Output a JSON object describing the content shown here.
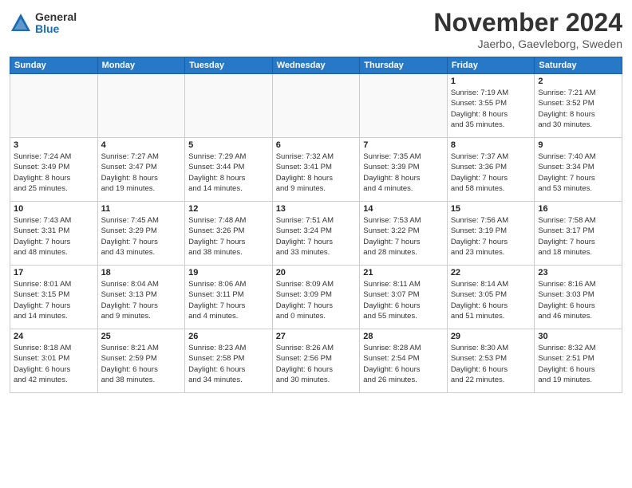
{
  "header": {
    "logo_general": "General",
    "logo_blue": "Blue",
    "month_title": "November 2024",
    "location": "Jaerbo, Gaevleborg, Sweden"
  },
  "weekdays": [
    "Sunday",
    "Monday",
    "Tuesday",
    "Wednesday",
    "Thursday",
    "Friday",
    "Saturday"
  ],
  "weeks": [
    [
      {
        "day": "",
        "info": ""
      },
      {
        "day": "",
        "info": ""
      },
      {
        "day": "",
        "info": ""
      },
      {
        "day": "",
        "info": ""
      },
      {
        "day": "",
        "info": ""
      },
      {
        "day": "1",
        "info": "Sunrise: 7:19 AM\nSunset: 3:55 PM\nDaylight: 8 hours\nand 35 minutes."
      },
      {
        "day": "2",
        "info": "Sunrise: 7:21 AM\nSunset: 3:52 PM\nDaylight: 8 hours\nand 30 minutes."
      }
    ],
    [
      {
        "day": "3",
        "info": "Sunrise: 7:24 AM\nSunset: 3:49 PM\nDaylight: 8 hours\nand 25 minutes."
      },
      {
        "day": "4",
        "info": "Sunrise: 7:27 AM\nSunset: 3:47 PM\nDaylight: 8 hours\nand 19 minutes."
      },
      {
        "day": "5",
        "info": "Sunrise: 7:29 AM\nSunset: 3:44 PM\nDaylight: 8 hours\nand 14 minutes."
      },
      {
        "day": "6",
        "info": "Sunrise: 7:32 AM\nSunset: 3:41 PM\nDaylight: 8 hours\nand 9 minutes."
      },
      {
        "day": "7",
        "info": "Sunrise: 7:35 AM\nSunset: 3:39 PM\nDaylight: 8 hours\nand 4 minutes."
      },
      {
        "day": "8",
        "info": "Sunrise: 7:37 AM\nSunset: 3:36 PM\nDaylight: 7 hours\nand 58 minutes."
      },
      {
        "day": "9",
        "info": "Sunrise: 7:40 AM\nSunset: 3:34 PM\nDaylight: 7 hours\nand 53 minutes."
      }
    ],
    [
      {
        "day": "10",
        "info": "Sunrise: 7:43 AM\nSunset: 3:31 PM\nDaylight: 7 hours\nand 48 minutes."
      },
      {
        "day": "11",
        "info": "Sunrise: 7:45 AM\nSunset: 3:29 PM\nDaylight: 7 hours\nand 43 minutes."
      },
      {
        "day": "12",
        "info": "Sunrise: 7:48 AM\nSunset: 3:26 PM\nDaylight: 7 hours\nand 38 minutes."
      },
      {
        "day": "13",
        "info": "Sunrise: 7:51 AM\nSunset: 3:24 PM\nDaylight: 7 hours\nand 33 minutes."
      },
      {
        "day": "14",
        "info": "Sunrise: 7:53 AM\nSunset: 3:22 PM\nDaylight: 7 hours\nand 28 minutes."
      },
      {
        "day": "15",
        "info": "Sunrise: 7:56 AM\nSunset: 3:19 PM\nDaylight: 7 hours\nand 23 minutes."
      },
      {
        "day": "16",
        "info": "Sunrise: 7:58 AM\nSunset: 3:17 PM\nDaylight: 7 hours\nand 18 minutes."
      }
    ],
    [
      {
        "day": "17",
        "info": "Sunrise: 8:01 AM\nSunset: 3:15 PM\nDaylight: 7 hours\nand 14 minutes."
      },
      {
        "day": "18",
        "info": "Sunrise: 8:04 AM\nSunset: 3:13 PM\nDaylight: 7 hours\nand 9 minutes."
      },
      {
        "day": "19",
        "info": "Sunrise: 8:06 AM\nSunset: 3:11 PM\nDaylight: 7 hours\nand 4 minutes."
      },
      {
        "day": "20",
        "info": "Sunrise: 8:09 AM\nSunset: 3:09 PM\nDaylight: 7 hours\nand 0 minutes."
      },
      {
        "day": "21",
        "info": "Sunrise: 8:11 AM\nSunset: 3:07 PM\nDaylight: 6 hours\nand 55 minutes."
      },
      {
        "day": "22",
        "info": "Sunrise: 8:14 AM\nSunset: 3:05 PM\nDaylight: 6 hours\nand 51 minutes."
      },
      {
        "day": "23",
        "info": "Sunrise: 8:16 AM\nSunset: 3:03 PM\nDaylight: 6 hours\nand 46 minutes."
      }
    ],
    [
      {
        "day": "24",
        "info": "Sunrise: 8:18 AM\nSunset: 3:01 PM\nDaylight: 6 hours\nand 42 minutes."
      },
      {
        "day": "25",
        "info": "Sunrise: 8:21 AM\nSunset: 2:59 PM\nDaylight: 6 hours\nand 38 minutes."
      },
      {
        "day": "26",
        "info": "Sunrise: 8:23 AM\nSunset: 2:58 PM\nDaylight: 6 hours\nand 34 minutes."
      },
      {
        "day": "27",
        "info": "Sunrise: 8:26 AM\nSunset: 2:56 PM\nDaylight: 6 hours\nand 30 minutes."
      },
      {
        "day": "28",
        "info": "Sunrise: 8:28 AM\nSunset: 2:54 PM\nDaylight: 6 hours\nand 26 minutes."
      },
      {
        "day": "29",
        "info": "Sunrise: 8:30 AM\nSunset: 2:53 PM\nDaylight: 6 hours\nand 22 minutes."
      },
      {
        "day": "30",
        "info": "Sunrise: 8:32 AM\nSunset: 2:51 PM\nDaylight: 6 hours\nand 19 minutes."
      }
    ]
  ]
}
